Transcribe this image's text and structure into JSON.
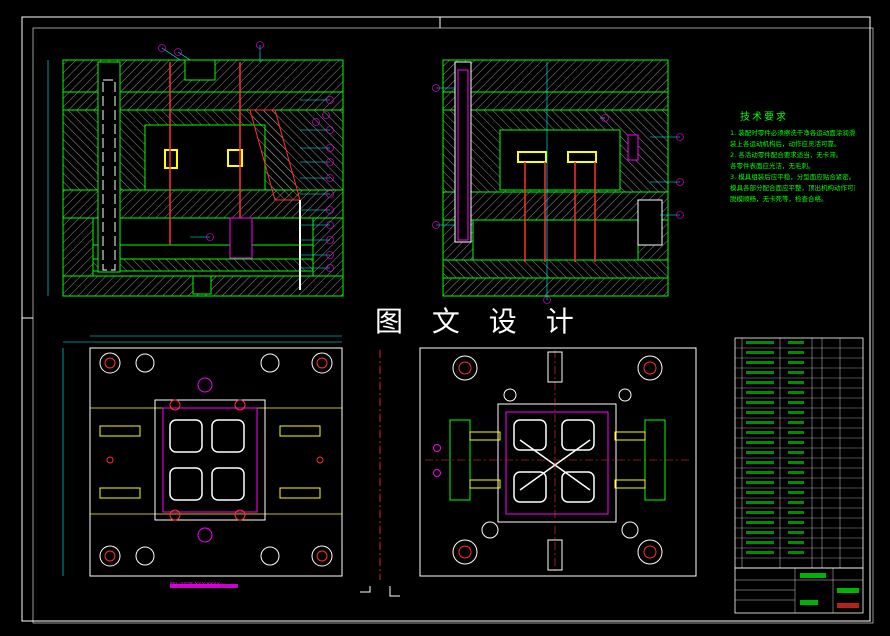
{
  "watermark": "图 文 设 计",
  "tech_requirements": {
    "title": "技术要求",
    "lines": [
      "1. 装配时零件必须擦洗干净各运动面涂润滑油。",
      "装上各运动机构后，动作应灵活可靠。",
      "2. 各活动零件配合要求适当，无卡滞。",
      "各零件表面应光洁，无毛刺。",
      "3. 模具组装后应平稳，分型面应贴合紧密。",
      "模具各部分配合面应平整，顶出机构动作可靠。",
      "脱模顺畅，无卡死等，检查合格。"
    ]
  },
  "bottom_label": "FSL-2025-XXX-XXXX",
  "colors": {
    "background": "#000000",
    "frame": "#ffffff",
    "plate_outline": "#00ff00",
    "hatch": "#c0c0c0",
    "leader": "#00ffff",
    "balloon": "#ff00ff",
    "pins": "#ff3030",
    "cavity": "#ffff00",
    "text_green": "#00ff00"
  }
}
